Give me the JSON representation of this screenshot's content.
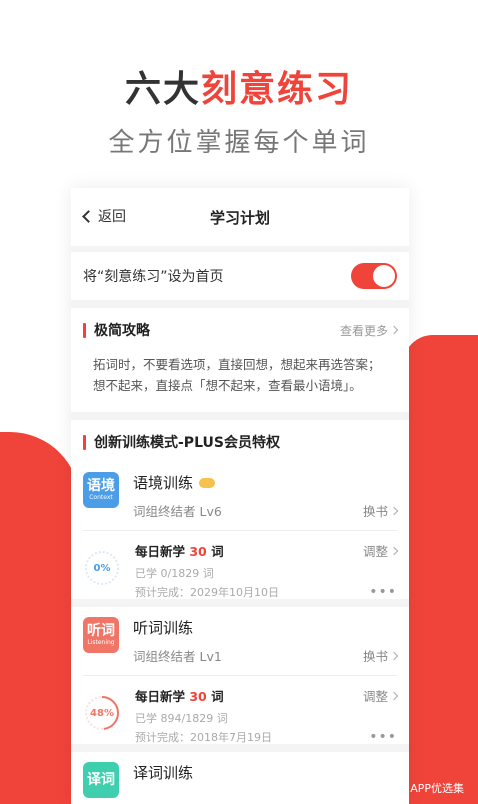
{
  "headline": {
    "prefix": "六大",
    "accent": "刻意练习"
  },
  "subline": "全方位掌握每个单词",
  "nav": {
    "back": "返回",
    "title": "学习计划"
  },
  "toggle_row": {
    "label": "将“刻意练习”设为首页",
    "on": true
  },
  "tips": {
    "title": "极简攻略",
    "more": "查看更多",
    "lines": [
      "拓词时，不要看选项，直接回想，想起来再选答案；",
      "想不起来，直接点「想不起来，查看最小语境」。"
    ]
  },
  "feature": {
    "title": "创新训练模式-PLUS会员特权"
  },
  "modes": [
    {
      "icon_main": "语境",
      "icon_sub": "Context",
      "name": "语境训练",
      "book": "词组终结者 Lv6",
      "switch": "换书",
      "plan": {
        "prefix": "每日新学 ",
        "count": "30",
        "suffix": " 词",
        "adjust": "调整",
        "learned": "已学 0/1829 词",
        "finish": "预计完成：2029年10月10日",
        "percent": "0%",
        "progress": 0
      }
    },
    {
      "icon_main": "听词",
      "icon_sub": "Listening",
      "name": "听词训练",
      "book": "词组终结者 Lv1",
      "switch": "换书",
      "plan": {
        "prefix": "每日新学 ",
        "count": "30",
        "suffix": " 词",
        "adjust": "调整",
        "learned": "已学 894/1829 词",
        "finish": "预计完成：2018年7月19日",
        "percent": "48%",
        "progress": 0.48
      }
    },
    {
      "icon_main": "译词",
      "name": "译词训练"
    }
  ],
  "dots": "•••",
  "watermark": "APP优选集"
}
